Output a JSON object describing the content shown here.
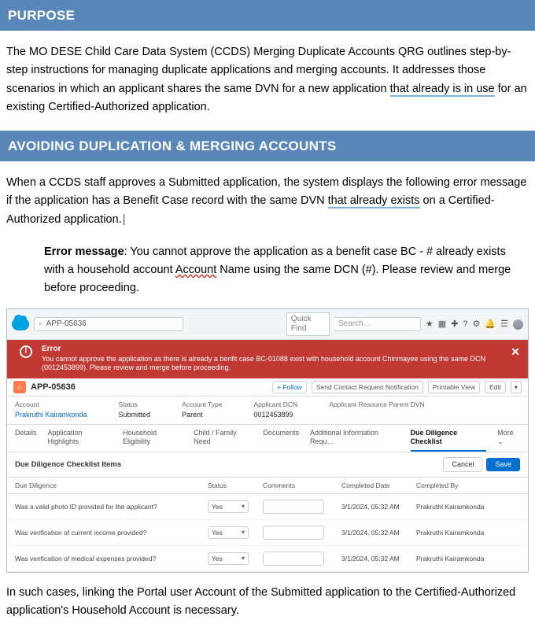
{
  "headers": {
    "purpose": "Purpose",
    "avoiding": "Avoiding Duplication & Merging Accounts"
  },
  "purpose_para_before_underline": "The MO DESE Child Care Data System (CCDS) Merging Duplicate Accounts QRG outlines step-by-step instructions for managing duplicate applications and merging accounts. It addresses those scenarios in which an applicant shares the same DVN for a new application ",
  "purpose_underline": "that already is in use",
  "purpose_para_after_underline": " for an existing Certified-Authorized application.",
  "avoid_para_before_underline": "When a CCDS staff approves a Submitted application, the system displays the following error message if the application has a Benefit Case record with the same DVN ",
  "avoid_underline": "that already exists",
  "avoid_para_after_underline": " on a Certified-Authorized application.",
  "error_msg": {
    "label": "Error message",
    "before_squiggle": ": You cannot approve the application as a benefit case BC - # already exists with a household account ",
    "squiggle": "Account",
    "after_squiggle": " Name using the same DCN (#). Please review and merge before proceeding."
  },
  "screenshot": {
    "search_icon": "⌕",
    "search_value": "APP-05636",
    "quick_find": "Quick Find",
    "search_placeholder": "Search...",
    "header_icons": {
      "star": "★",
      "grid": "▦",
      "plus": "✚",
      "help": "?",
      "gear": "⚙",
      "bell": "🔔",
      "menu": "☰"
    },
    "error": {
      "icon": "!",
      "title": "Error",
      "text": "You cannot approve the application as there is already a benfit case BC-01088 exist with household account Chinmayee using the same DCN (0012453899). Please review and merge before proceeding.",
      "close": "✕"
    },
    "object": {
      "icon": "⌂",
      "title": "APP-05636",
      "follow": "+ Follow",
      "notify": "Send Contact Request Notification",
      "printable": "Printable View",
      "edit": "Edit",
      "caret": "▾"
    },
    "record": {
      "account_lbl": "Account",
      "account_val": "Prakruthi Kairamkonda",
      "status_lbl": "Status",
      "status_val": "Submitted",
      "acct_type_lbl": "Account Type",
      "acct_type_val": "Parent",
      "applicant_dcn_lbl": "Applicant DCN",
      "applicant_dcn_val": "0012453899",
      "resource_dvn_lbl": "Applicant Resource Parent DVN"
    },
    "tabs": {
      "details": "Details",
      "app_high": "Application Highlights",
      "hh_elig": "Household Eligibility",
      "child": "Child / Family Need",
      "docs": "Documents",
      "addl": "Additional Information Requ…",
      "ddc": "Due Diligence Checklist",
      "more": "More ⌄"
    },
    "ddci": {
      "title": "Due Diligence Checklist Items",
      "cancel": "Cancel",
      "save": "Save"
    },
    "thead": {
      "dd": "Due Diligence",
      "status": "Status",
      "comments": "Comments",
      "cd": "Completed Date",
      "cb": "Completed By"
    },
    "rows": [
      {
        "q": "Was a valid photo ID provided for the applicant?",
        "status": "Yes",
        "cd": "3/1/2024, 05:32 AM",
        "cb": "Prakruthi Kairamkonda"
      },
      {
        "q": "Was verification of current income provided?",
        "status": "Yes",
        "cd": "3/1/2024, 05:32 AM",
        "cb": "Prakruthi Kairamkonda"
      },
      {
        "q": "Was verification of medical expenses provided?",
        "status": "Yes",
        "cd": "3/1/2024, 05:32 AM",
        "cb": "Prakruthi Kairamkonda"
      }
    ],
    "caret": "▾"
  },
  "after_para": "In such cases, linking the Portal user Account of the Submitted application to the Certified-Authorized application's Household Account is necessary."
}
